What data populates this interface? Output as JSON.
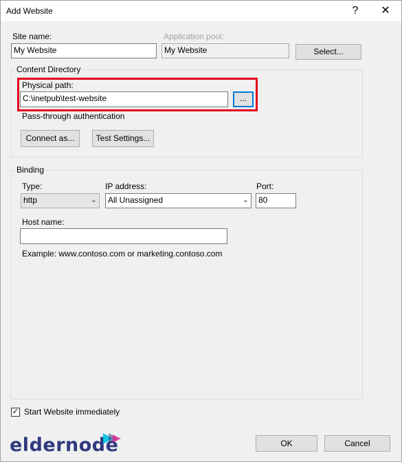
{
  "window": {
    "title": "Add Website",
    "help_glyph": "?",
    "close_glyph": "✕"
  },
  "site": {
    "name_label": "Site name:",
    "name_value": "My Website",
    "pool_label": "Application pool:",
    "pool_value": "My Website",
    "select_button": "Select..."
  },
  "content_directory": {
    "group_label": "Content Directory",
    "path_label": "Physical path:",
    "path_value": "C:\\inetpub\\test-website",
    "browse_button": "...",
    "auth_label": "Pass-through authentication",
    "connect_button": "Connect as...",
    "test_button": "Test Settings..."
  },
  "binding": {
    "group_label": "Binding",
    "type_label": "Type:",
    "type_value": "http",
    "ip_label": "IP address:",
    "ip_value": "All Unassigned",
    "port_label": "Port:",
    "port_value": "80",
    "host_label": "Host name:",
    "host_value": "",
    "example_text": "Example: www.contoso.com or marketing.contoso.com"
  },
  "start_immediately": {
    "label": "Start Website immediately",
    "checked": true,
    "check_glyph": "✓"
  },
  "footer": {
    "ok_button": "OK",
    "cancel_button": "Cancel"
  },
  "watermark": {
    "text": "eldernode"
  },
  "colors": {
    "highlight": "#e3001b",
    "accent": "#0078d7",
    "logo": "#2f3a7e",
    "logo_arrow": "#00c2e0"
  }
}
